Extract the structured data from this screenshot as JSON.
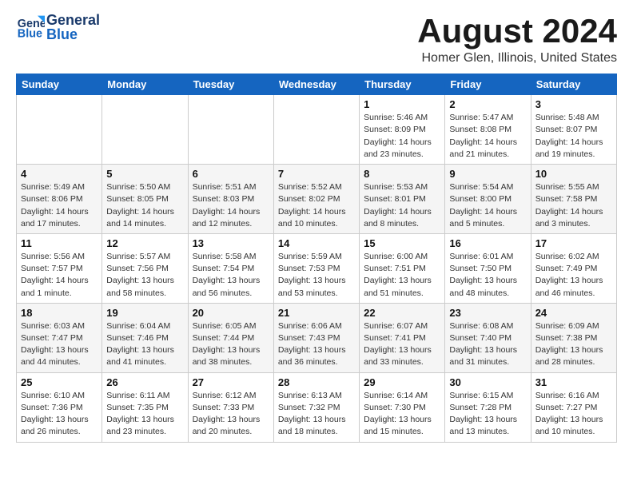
{
  "header": {
    "logo_general": "General",
    "logo_blue": "Blue",
    "month_title": "August 2024",
    "location": "Homer Glen, Illinois, United States"
  },
  "weekdays": [
    "Sunday",
    "Monday",
    "Tuesday",
    "Wednesday",
    "Thursday",
    "Friday",
    "Saturday"
  ],
  "weeks": [
    [
      {
        "day": "",
        "info": ""
      },
      {
        "day": "",
        "info": ""
      },
      {
        "day": "",
        "info": ""
      },
      {
        "day": "",
        "info": ""
      },
      {
        "day": "1",
        "info": "Sunrise: 5:46 AM\nSunset: 8:09 PM\nDaylight: 14 hours\nand 23 minutes."
      },
      {
        "day": "2",
        "info": "Sunrise: 5:47 AM\nSunset: 8:08 PM\nDaylight: 14 hours\nand 21 minutes."
      },
      {
        "day": "3",
        "info": "Sunrise: 5:48 AM\nSunset: 8:07 PM\nDaylight: 14 hours\nand 19 minutes."
      }
    ],
    [
      {
        "day": "4",
        "info": "Sunrise: 5:49 AM\nSunset: 8:06 PM\nDaylight: 14 hours\nand 17 minutes."
      },
      {
        "day": "5",
        "info": "Sunrise: 5:50 AM\nSunset: 8:05 PM\nDaylight: 14 hours\nand 14 minutes."
      },
      {
        "day": "6",
        "info": "Sunrise: 5:51 AM\nSunset: 8:03 PM\nDaylight: 14 hours\nand 12 minutes."
      },
      {
        "day": "7",
        "info": "Sunrise: 5:52 AM\nSunset: 8:02 PM\nDaylight: 14 hours\nand 10 minutes."
      },
      {
        "day": "8",
        "info": "Sunrise: 5:53 AM\nSunset: 8:01 PM\nDaylight: 14 hours\nand 8 minutes."
      },
      {
        "day": "9",
        "info": "Sunrise: 5:54 AM\nSunset: 8:00 PM\nDaylight: 14 hours\nand 5 minutes."
      },
      {
        "day": "10",
        "info": "Sunrise: 5:55 AM\nSunset: 7:58 PM\nDaylight: 14 hours\nand 3 minutes."
      }
    ],
    [
      {
        "day": "11",
        "info": "Sunrise: 5:56 AM\nSunset: 7:57 PM\nDaylight: 14 hours\nand 1 minute."
      },
      {
        "day": "12",
        "info": "Sunrise: 5:57 AM\nSunset: 7:56 PM\nDaylight: 13 hours\nand 58 minutes."
      },
      {
        "day": "13",
        "info": "Sunrise: 5:58 AM\nSunset: 7:54 PM\nDaylight: 13 hours\nand 56 minutes."
      },
      {
        "day": "14",
        "info": "Sunrise: 5:59 AM\nSunset: 7:53 PM\nDaylight: 13 hours\nand 53 minutes."
      },
      {
        "day": "15",
        "info": "Sunrise: 6:00 AM\nSunset: 7:51 PM\nDaylight: 13 hours\nand 51 minutes."
      },
      {
        "day": "16",
        "info": "Sunrise: 6:01 AM\nSunset: 7:50 PM\nDaylight: 13 hours\nand 48 minutes."
      },
      {
        "day": "17",
        "info": "Sunrise: 6:02 AM\nSunset: 7:49 PM\nDaylight: 13 hours\nand 46 minutes."
      }
    ],
    [
      {
        "day": "18",
        "info": "Sunrise: 6:03 AM\nSunset: 7:47 PM\nDaylight: 13 hours\nand 44 minutes."
      },
      {
        "day": "19",
        "info": "Sunrise: 6:04 AM\nSunset: 7:46 PM\nDaylight: 13 hours\nand 41 minutes."
      },
      {
        "day": "20",
        "info": "Sunrise: 6:05 AM\nSunset: 7:44 PM\nDaylight: 13 hours\nand 38 minutes."
      },
      {
        "day": "21",
        "info": "Sunrise: 6:06 AM\nSunset: 7:43 PM\nDaylight: 13 hours\nand 36 minutes."
      },
      {
        "day": "22",
        "info": "Sunrise: 6:07 AM\nSunset: 7:41 PM\nDaylight: 13 hours\nand 33 minutes."
      },
      {
        "day": "23",
        "info": "Sunrise: 6:08 AM\nSunset: 7:40 PM\nDaylight: 13 hours\nand 31 minutes."
      },
      {
        "day": "24",
        "info": "Sunrise: 6:09 AM\nSunset: 7:38 PM\nDaylight: 13 hours\nand 28 minutes."
      }
    ],
    [
      {
        "day": "25",
        "info": "Sunrise: 6:10 AM\nSunset: 7:36 PM\nDaylight: 13 hours\nand 26 minutes."
      },
      {
        "day": "26",
        "info": "Sunrise: 6:11 AM\nSunset: 7:35 PM\nDaylight: 13 hours\nand 23 minutes."
      },
      {
        "day": "27",
        "info": "Sunrise: 6:12 AM\nSunset: 7:33 PM\nDaylight: 13 hours\nand 20 minutes."
      },
      {
        "day": "28",
        "info": "Sunrise: 6:13 AM\nSunset: 7:32 PM\nDaylight: 13 hours\nand 18 minutes."
      },
      {
        "day": "29",
        "info": "Sunrise: 6:14 AM\nSunset: 7:30 PM\nDaylight: 13 hours\nand 15 minutes."
      },
      {
        "day": "30",
        "info": "Sunrise: 6:15 AM\nSunset: 7:28 PM\nDaylight: 13 hours\nand 13 minutes."
      },
      {
        "day": "31",
        "info": "Sunrise: 6:16 AM\nSunset: 7:27 PM\nDaylight: 13 hours\nand 10 minutes."
      }
    ]
  ]
}
